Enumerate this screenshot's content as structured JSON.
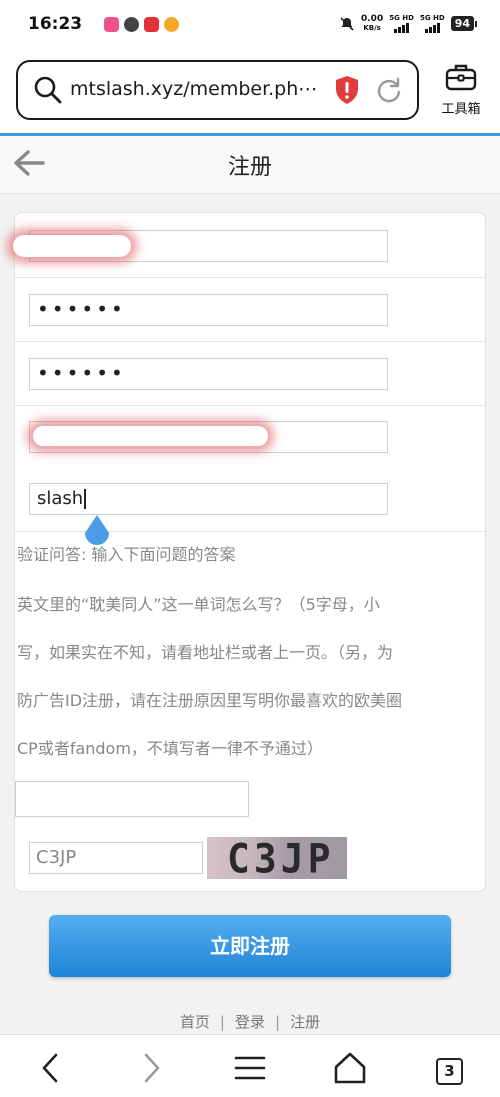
{
  "status_bar": {
    "time": "16:23",
    "net_speed_value": "0.00",
    "net_speed_unit": "KB/s",
    "net1": "5G HD",
    "net2": "5G HD",
    "battery": "94"
  },
  "browser": {
    "url": "mtslash.xyz/member.ph⋯",
    "toolbox_label": "工具箱",
    "tab_count": "3"
  },
  "page": {
    "title": "注册"
  },
  "form": {
    "password_mask": "••••••",
    "confirm_password_mask": "••••••",
    "reason_value": "slash",
    "qa_label": "验证问答: 输入下面问题的答案",
    "qa_question_line1": "英文里的“耽美同人”这一单词怎么写？（5字母，小",
    "qa_question_line2": "写，如果实在不知，请看地址栏或者上一页。（另，为",
    "qa_question_line3": "防广告ID注册，请在注册原因里写明你最喜欢的欧美圈",
    "qa_question_line4": "CP或者fandom，不填写者一律不予通过）",
    "captcha_input_value": "C3JP",
    "captcha_image_text": "C3JP",
    "submit_label": "立即注册"
  },
  "footer": {
    "links": [
      "首页",
      "登录",
      "注册"
    ],
    "separator": "|"
  },
  "colors": {
    "accent_blue": "#1f84d6",
    "shield_red": "#e23b3b"
  }
}
